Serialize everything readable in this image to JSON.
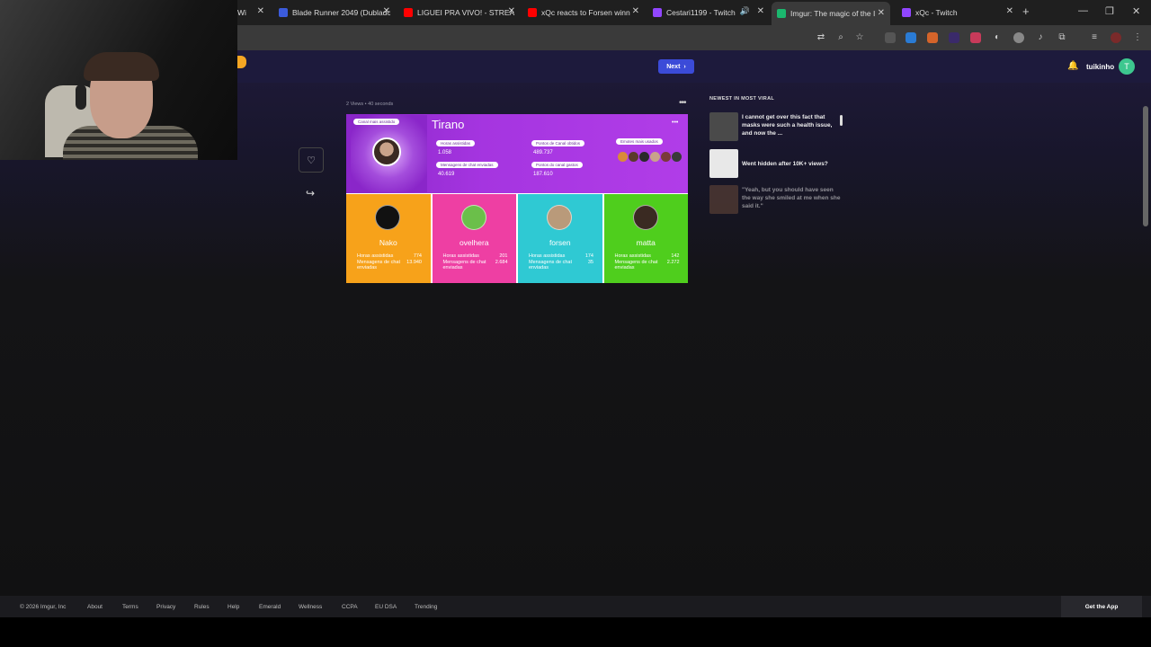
{
  "browser": {
    "tabs": [
      {
        "label": "Wi",
        "favicon_color": "#888888",
        "active": false
      },
      {
        "label": "Blade Runner 2049 (Dublado",
        "favicon_color": "#3b5bdb",
        "active": false
      },
      {
        "label": "LIGUEI PRA VIVO! - STREA",
        "favicon_color": "#ff0000",
        "active": false
      },
      {
        "label": "xQc reacts to Forsen winn",
        "favicon_color": "#ff0000",
        "active": false
      },
      {
        "label": "Cestari1199 - Twitch",
        "favicon_color": "#9146ff",
        "active": false
      },
      {
        "label": "Imgur: The magic of the I",
        "favicon_color": "#1bb76e",
        "active": true
      },
      {
        "label": "xQc - Twitch",
        "favicon_color": "#9146ff",
        "active": false
      }
    ],
    "new_tab": "+",
    "window_controls": {
      "minimize": "—",
      "restore": "❐",
      "close": "✕"
    }
  },
  "imgur": {
    "next_label": "Next",
    "username": "tuikinho",
    "avatar_letter": "T",
    "post_meta": "2 Views • 40 seconds",
    "sidebar_title": "NEWEST IN MOST VIRAL",
    "sidebar_items": [
      {
        "text": "I cannot get over this fact that masks were such a health issue, and now the ...",
        "thumb_color": "#4a4a4a"
      },
      {
        "text": "Went hidden after 10K+ views?",
        "thumb_color": "#e8e8e8"
      },
      {
        "text": "\"Yeah, but you should have seen the way she smiled at me when she said it.\"",
        "thumb_color": "#6a4a3a"
      }
    ]
  },
  "post_image": {
    "badge": "Canal mais assistido",
    "channel": "Tirano",
    "stats": [
      {
        "label": "Horas assistidas",
        "value": "1.058"
      },
      {
        "label": "Mensagens de chat enviadas",
        "value": "40.619"
      },
      {
        "label": "Pontos de Canal obtidos",
        "value": "489.737"
      },
      {
        "label": "Pontos do canal gastos",
        "value": "187.610"
      }
    ],
    "emotes_label": "Emotes mais usados",
    "emote_colors": [
      "#d98a3a",
      "#5a3a2a",
      "#2a2a2a",
      "#c9a38a",
      "#7a3a3a",
      "#3a3a3a"
    ],
    "channels": [
      {
        "name": "Nako",
        "hours_label": "Horas assistidas",
        "hours": "774",
        "msgs_label": "Mensagens de chat enviadas",
        "msgs": "13.940",
        "color": "#f7a21a",
        "avatar_color": "#111111"
      },
      {
        "name": "ovelhera",
        "hours_label": "Horas assistidas",
        "hours": "201",
        "msgs_label": "Mensagens de chat enviadas",
        "msgs": "2.684",
        "color": "#ee3fa3",
        "avatar_color": "#6bbf4a"
      },
      {
        "name": "forsen",
        "hours_label": "Horas assistidas",
        "hours": "174",
        "msgs_label": "Mensagens de chat enviadas",
        "msgs": "35",
        "color": "#2fc9d3",
        "avatar_color": "#b99a7a"
      },
      {
        "name": "matta",
        "hours_label": "Horas assistidas",
        "hours": "142",
        "msgs_label": "Mensagens de chat enviadas",
        "msgs": "2.272",
        "color": "#4fce1d",
        "avatar_color": "#3a2a22"
      }
    ]
  },
  "footer": {
    "copyright": "© 2026 Imgur, Inc",
    "links": [
      "About",
      "Terms",
      "Privacy",
      "Rules",
      "Help",
      "Emerald",
      "Wellness",
      "CCPA",
      "EU DSA",
      "Trending"
    ],
    "get_app": "Get the App"
  }
}
